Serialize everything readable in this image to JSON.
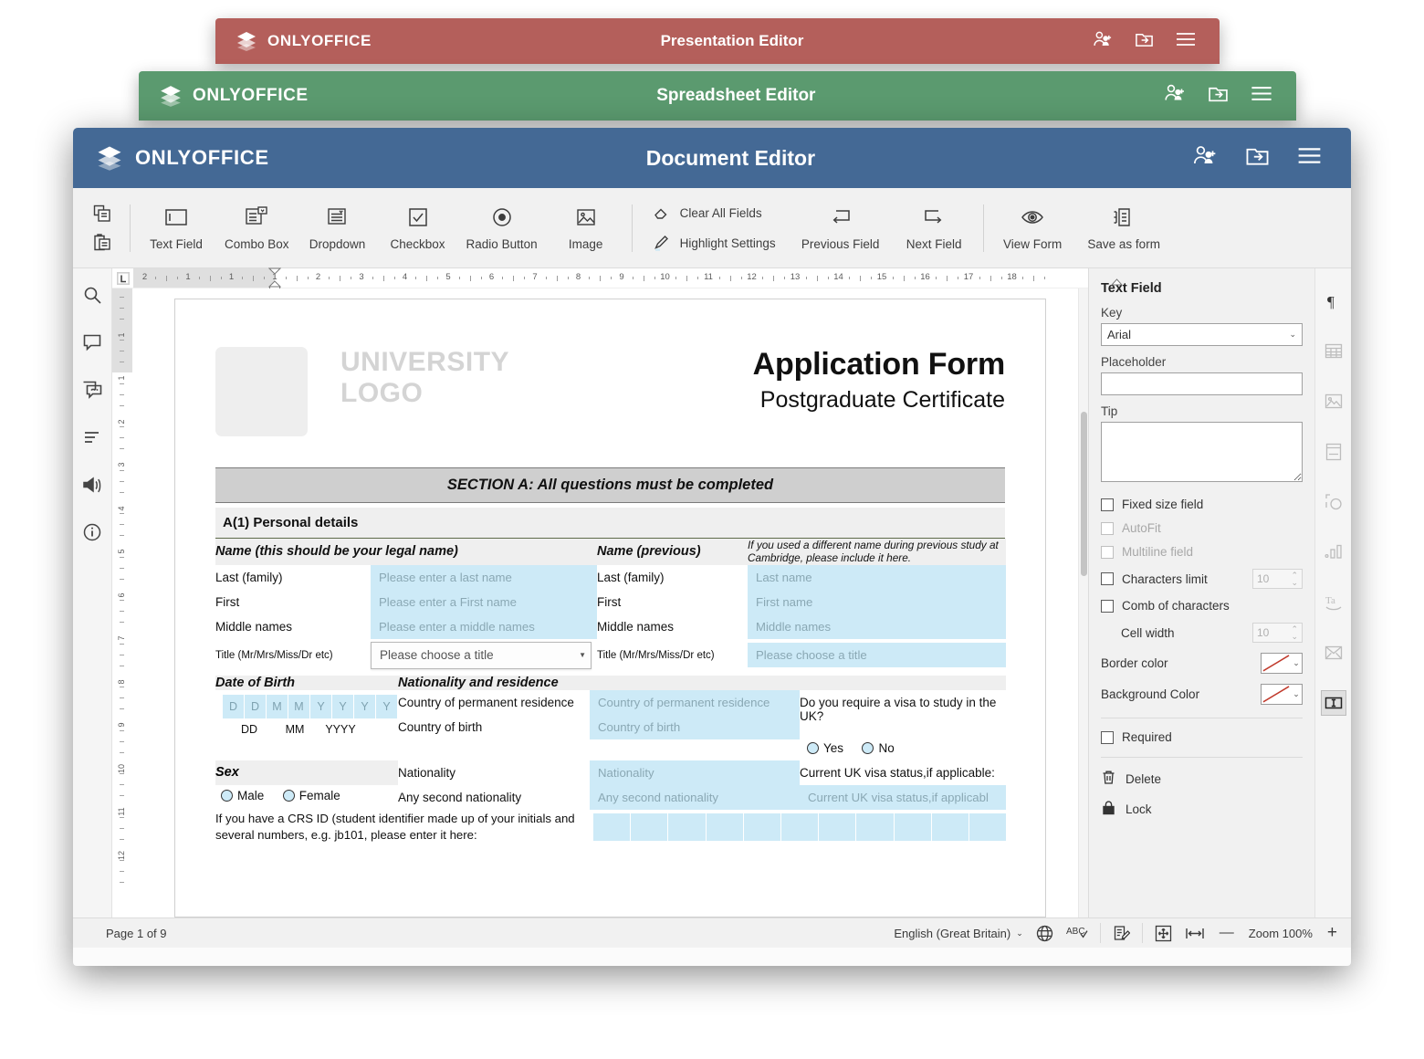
{
  "windows": {
    "presentation": {
      "wordmark": "ONLYOFFICE",
      "title": "Presentation Editor",
      "color": "#b45f5b"
    },
    "spreadsheet": {
      "wordmark": "ONLYOFFICE",
      "title": "Spreadsheet Editor",
      "color": "#5b9a6f"
    },
    "document": {
      "wordmark": "ONLYOFFICE",
      "title": "Document Editor",
      "color": "#446995"
    }
  },
  "titlebar_actions": [
    {
      "icon": "add-collaborator-icon"
    },
    {
      "icon": "open-file-location-icon"
    },
    {
      "icon": "hamburger-menu-icon"
    }
  ],
  "toolbar": {
    "clipboard": [
      {
        "icon": "copy-icon",
        "name": "copy-button"
      },
      {
        "icon": "paste-icon",
        "name": "paste-button"
      }
    ],
    "fields": [
      {
        "label": "Text Field",
        "icon": "text-field-icon"
      },
      {
        "label": "Combo Box",
        "icon": "combo-box-icon"
      },
      {
        "label": "Dropdown",
        "icon": "dropdown-icon"
      },
      {
        "label": "Checkbox",
        "icon": "checkbox-icon"
      },
      {
        "label": "Radio Button",
        "icon": "radio-button-icon"
      },
      {
        "label": "Image",
        "icon": "image-icon"
      }
    ],
    "stacked": [
      {
        "label": "Clear All Fields",
        "icon": "eraser-icon"
      },
      {
        "label": "Highlight Settings",
        "icon": "highlighter-icon"
      }
    ],
    "nav": [
      {
        "label": "Previous Field",
        "icon": "previous-field-icon"
      },
      {
        "label": "Next Field",
        "icon": "next-field-icon"
      }
    ],
    "view": [
      {
        "label": "View Form",
        "icon": "view-form-icon"
      },
      {
        "label": "Save as form",
        "icon": "save-as-form-icon"
      }
    ]
  },
  "left_rail": [
    {
      "icon": "search-icon",
      "name": "sidebar-item-search"
    },
    {
      "icon": "comments-icon",
      "name": "sidebar-item-comments"
    },
    {
      "icon": "chat-icon",
      "name": "sidebar-item-chat"
    },
    {
      "icon": "headings-icon",
      "name": "sidebar-item-navigation"
    },
    {
      "icon": "feedback-icon",
      "name": "sidebar-item-feedback"
    },
    {
      "icon": "about-icon",
      "name": "sidebar-item-about"
    }
  ],
  "right_rail": [
    {
      "icon": "paragraph-settings-icon",
      "name": "panel-tab-paragraph",
      "active": false
    },
    {
      "icon": "table-settings-icon",
      "name": "panel-tab-table",
      "active": false
    },
    {
      "icon": "image-settings-icon",
      "name": "panel-tab-image",
      "active": false
    },
    {
      "icon": "header-footer-settings-icon",
      "name": "panel-tab-header-footer",
      "active": false
    },
    {
      "icon": "shape-settings-icon",
      "name": "panel-tab-shape",
      "active": false
    },
    {
      "icon": "chart-settings-icon",
      "name": "panel-tab-chart",
      "active": false
    },
    {
      "icon": "text-art-settings-icon",
      "name": "panel-tab-text-art",
      "active": false
    },
    {
      "icon": "mail-merge-icon",
      "name": "panel-tab-mail-merge",
      "active": false
    },
    {
      "icon": "form-settings-icon",
      "name": "panel-tab-form-settings",
      "active": true
    }
  ],
  "panel": {
    "title": "Text Field",
    "key_label": "Key",
    "key_value": "Arial",
    "placeholder_label": "Placeholder",
    "placeholder_value": "",
    "tip_label": "Tip",
    "tip_value": "",
    "fixed_size_label": "Fixed size  field",
    "autofit_label": "AutoFit",
    "multiline_label": "Multiline field",
    "characters_limit_label": "Characters limit",
    "characters_limit_value": "10",
    "comb_label": "Comb of characters",
    "cell_width_label": "Cell width",
    "cell_width_value": "10",
    "border_color_label": "Border color",
    "background_color_label": "Background Color",
    "required_label": "Required",
    "delete_label": "Delete",
    "lock_label": "Lock",
    "no_fill_color": "#c0392b"
  },
  "statusbar": {
    "page_indicator": "Page 1 of 9",
    "language": "English  (Great Britain)",
    "zoom_label": "Zoom 100%",
    "minus": "—",
    "plus": "+",
    "icons": [
      {
        "icon": "set-language-icon",
        "name": "set-document-language-button"
      },
      {
        "icon": "spell-check-icon",
        "name": "spell-check-button"
      },
      {
        "icon": "track-changes-icon",
        "name": "track-changes-button"
      },
      {
        "icon": "fit-to-page-icon",
        "name": "fit-to-page-button"
      },
      {
        "icon": "fit-to-width-icon",
        "name": "fit-to-width-button"
      }
    ]
  },
  "ruler": {
    "h_numbers": [
      "2",
      "1",
      "1",
      "1",
      "2",
      "3",
      "4",
      "5",
      "6",
      "7",
      "8",
      "9",
      "10",
      "11",
      "12",
      "13",
      "14",
      "15",
      "16",
      "17",
      "18"
    ],
    "v_numbers": [
      "1",
      "1",
      "2",
      "3",
      "4",
      "5",
      "6",
      "7",
      "8",
      "9",
      "10",
      "11",
      "12"
    ]
  },
  "document": {
    "logo_text": "UNIVERSITY\nLOGO",
    "title": "Application Form",
    "subtitle": "Postgraduate Certificate",
    "section_band": "SECTION A: All questions must be completed",
    "subsection": "A(1) Personal details",
    "name_header_legal": "Name (this should be your legal name)",
    "name_header_previous": "Name (previous)",
    "name_note": "If you used a different name during previous study at Cambridge, please include it here.",
    "name_rows": [
      {
        "label": "Last (family)",
        "ph_legal": "Please enter a last name",
        "ph_prev": "Last name"
      },
      {
        "label": "First",
        "ph_legal": "Please enter a First name",
        "ph_prev": "First name"
      },
      {
        "label": "Middle names",
        "ph_legal": "Please enter a middle names",
        "ph_prev": "Middle names"
      }
    ],
    "title_row_label": "Title (Mr/Mrs/Miss/Dr etc)",
    "title_combo_value": "Please choose a title",
    "title_prev_value": "Please choose a title",
    "dob_header": "Date of Birth",
    "nationality_header": "Nationality and residence",
    "dob_cells": [
      "D",
      "D",
      "M",
      "M",
      "Y",
      "Y",
      "Y",
      "Y"
    ],
    "dob_labels": [
      "DD",
      "MM",
      "YYYY"
    ],
    "sex_header": "Sex",
    "sex_options": [
      "Male",
      "Female"
    ],
    "residence_rows": [
      {
        "label": "Country of permanent residence",
        "ph": "Country of permanent residence"
      },
      {
        "label": "Country of birth",
        "ph": "Country of birth"
      },
      {
        "label": "Nationality",
        "ph": "Nationality"
      },
      {
        "label": "Any second nationality",
        "ph": "Any second nationality"
      }
    ],
    "visa_question": "Do you require a visa to study in the UK?",
    "visa_options": [
      "Yes",
      "No"
    ],
    "visa_status_label": "Current UK visa status,if applicable:",
    "visa_status_ph": "Current UK visa status,if applicabl",
    "crs_text": "If you have a CRS ID (student identifier made up of your initials and several numbers, e.g. jb101, please enter it here:",
    "crs_cells": 11
  }
}
